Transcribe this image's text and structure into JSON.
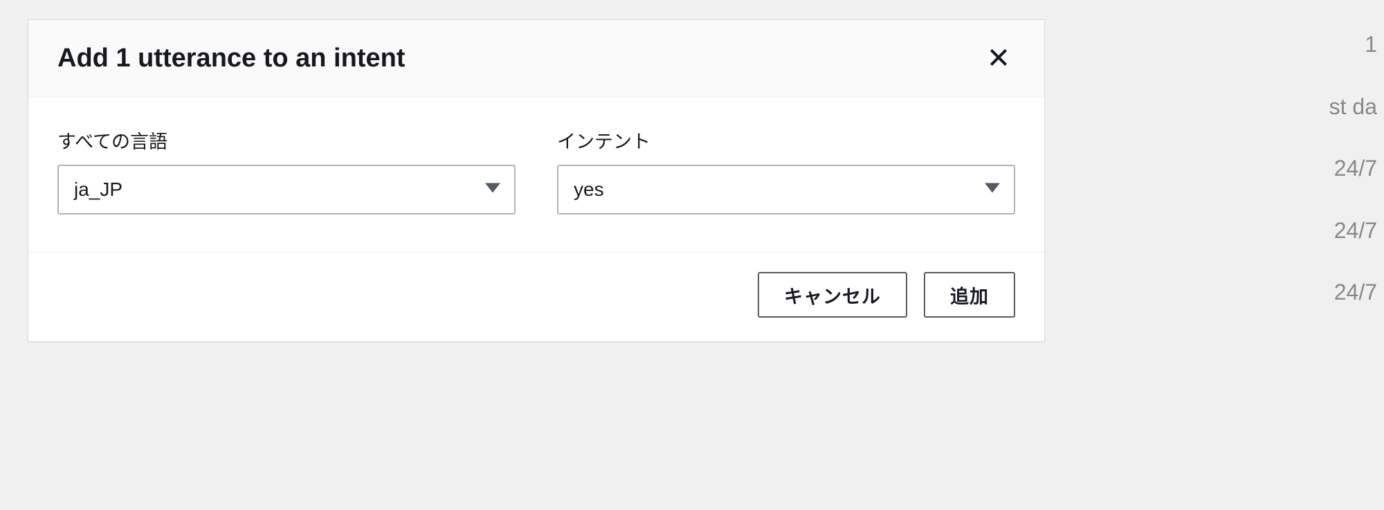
{
  "modal": {
    "title": "Add 1 utterance to an intent",
    "fields": {
      "language": {
        "label": "すべての言語",
        "value": "ja_JP"
      },
      "intent": {
        "label": "インテント",
        "value": "yes"
      }
    },
    "buttons": {
      "cancel": "キャンセル",
      "add": "追加"
    }
  },
  "background": {
    "line1": "1",
    "line2": "st da",
    "line3": "24/7",
    "line4": "24/7",
    "line5": "24/7"
  }
}
